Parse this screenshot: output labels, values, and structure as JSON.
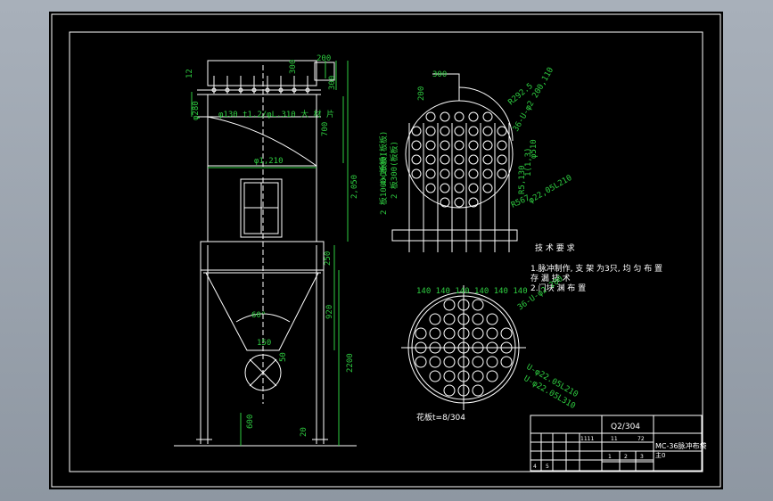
{
  "drawing": {
    "dims": {
      "d_200": "200",
      "d_12": "12",
      "d_300_top": "300",
      "d_300_right": "300",
      "d_phi280": "φ280",
      "d_tube": "φ130 t1.2/φL.310 大 材 片",
      "d_700": "700",
      "d_phi1210": "φ1,210",
      "d_2050": "2,050",
      "d_250": "250",
      "d_920": "920",
      "d_2200": "2200",
      "d_60deg": "60°",
      "d_150": "150",
      "d_50": "50",
      "d_600": "600",
      "d_20": "20",
      "d_300_plan": "300",
      "d_plan_200": "200",
      "d_r292": "R292.5",
      "d_rings1": "36-U-φ2 200,110",
      "d_left_a": "4×1000(板板)",
      "d_left_b": "2 板300(板板)",
      "d_left_c": "2 板1000(板板)",
      "d_right_a": "φ510",
      "d_right_b": "R5,130",
      "d_right_c": "1(1,3)",
      "d_right_d": "R567",
      "d_right_e": "φ22,05L210",
      "d_top_row": "140 140 140 140 140 140",
      "d_bottom_a": "36-U-φ2 200",
      "d_bottom_b": "U-φ22.05L210",
      "d_bottom_c": "U-φ22.05L310",
      "plate_label": "花板t=8/304"
    },
    "notes": {
      "title": "技 术 要 求",
      "line1": "1.脉冲制作, 支 架 为3只, 均 匀 布 置",
      "line2": "存 漏 技 术",
      "line3": "2.门块 渊 布 置"
    },
    "title_block": {
      "material": "Q2/304",
      "drawing_no": "MC-36脉冲布袋",
      "sub": "主0",
      "cells": [
        "1111",
        "11",
        "72",
        "1",
        "2",
        "3",
        "4",
        "5"
      ]
    }
  }
}
